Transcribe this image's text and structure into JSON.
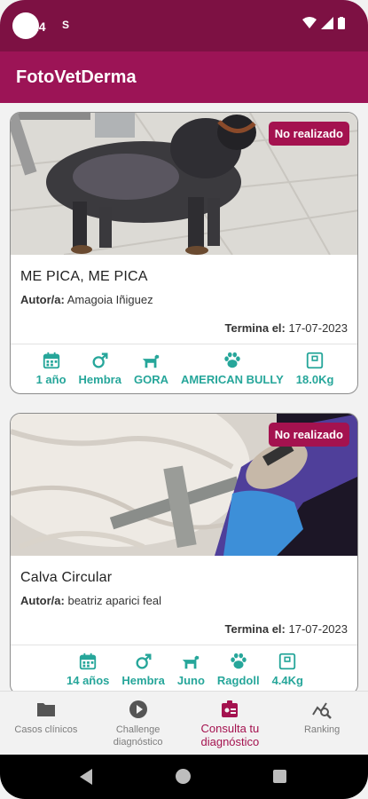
{
  "status_bar": {
    "time": "24",
    "carrier_icon": "S"
  },
  "app": {
    "title": "FotoVetDerma"
  },
  "cards": [
    {
      "badge": "No realizado",
      "title": "ME PICA, ME PICA",
      "author_label": "Autor/a:",
      "author": "Amagoia Iñiguez",
      "deadline_label": "Termina el:",
      "deadline": "17-07-2023",
      "age": "1 año",
      "sex": "Hembra",
      "name": "GORA",
      "breed": "AMERICAN BULLY",
      "weight": "18.0Kg"
    },
    {
      "badge": "No realizado",
      "title": "Calva Circular",
      "author_label": "Autor/a:",
      "author": "beatriz aparici feal",
      "deadline_label": "Termina el:",
      "deadline": "17-07-2023",
      "age": "14 años",
      "sex": "Hembra",
      "name": "Juno",
      "breed": "Ragdoll",
      "weight": "4.4Kg"
    }
  ],
  "nav": [
    {
      "label": "Casos clínicos",
      "icon": "folder-icon"
    },
    {
      "label": "Challenge diagnóstico",
      "icon": "play-icon"
    },
    {
      "label": "Consulta tu diagnóstico",
      "icon": "id-card-icon",
      "active": true
    },
    {
      "label": "Ranking",
      "icon": "chart-search-icon"
    }
  ],
  "colors": {
    "primary_dark": "#7d1143",
    "primary": "#9c1456",
    "accent": "#a4124f",
    "teal": "#26a69a"
  }
}
